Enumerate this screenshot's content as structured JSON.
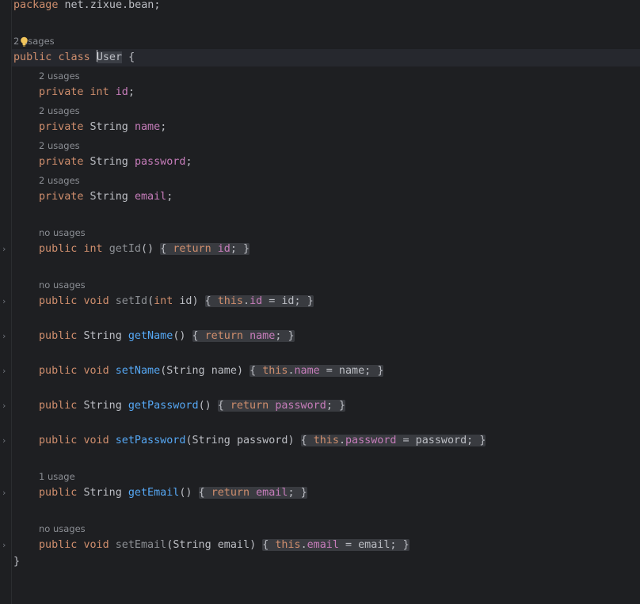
{
  "package_line": {
    "keyword": "package",
    "name": "net.zixue.bean;"
  },
  "class_hint": "2 usages",
  "class_decl": {
    "kw1": "public",
    "kw2": "class",
    "name": "User",
    "brace": "{"
  },
  "fields": [
    {
      "hint": "2 usages",
      "kw": "private",
      "type": "int",
      "name": "id",
      "end": ";"
    },
    {
      "hint": "2 usages",
      "kw": "private",
      "type": "String",
      "name": "name",
      "end": ";"
    },
    {
      "hint": "2 usages",
      "kw": "private",
      "type": "String",
      "name": "password",
      "end": ";"
    },
    {
      "hint": "2 usages",
      "kw": "private",
      "type": "String",
      "name": "email",
      "end": ";"
    }
  ],
  "methods": [
    {
      "hint": "no usages",
      "kw": "public",
      "ret": "int",
      "name": "getId",
      "params": "()",
      "ret_kw": "return",
      "field": "id",
      "semi": ";"
    },
    {
      "hint": "no usages",
      "kw": "public",
      "ret": "void",
      "name": "setId",
      "params_open": "(",
      "param_type": "int",
      "param_name": "id",
      "params_close": ")",
      "this_kw": "this",
      "field": "id",
      "assign": " = id;"
    },
    {
      "kw": "public",
      "ret": "String",
      "name": "getName",
      "params": "()",
      "ret_kw": "return",
      "field": "name",
      "semi": ";"
    },
    {
      "kw": "public",
      "ret": "void",
      "name": "setName",
      "params_open": "(",
      "param_type": "String",
      "param_name": "name",
      "params_close": ")",
      "this_kw": "this",
      "field": "name",
      "assign": " = name;"
    },
    {
      "kw": "public",
      "ret": "String",
      "name": "getPassword",
      "params": "()",
      "ret_kw": "return",
      "field": "password",
      "semi": ";"
    },
    {
      "kw": "public",
      "ret": "void",
      "name": "setPassword",
      "params_open": "(",
      "param_type": "String",
      "param_name": "password",
      "params_close": ")",
      "this_kw": "this",
      "field": "password",
      "assign": " = password;"
    },
    {
      "hint": "1 usage",
      "kw": "public",
      "ret": "String",
      "name": "getEmail",
      "params": "()",
      "ret_kw": "return",
      "field": "email",
      "semi": ";"
    },
    {
      "hint": "no usages",
      "kw": "public",
      "ret": "void",
      "name": "setEmail",
      "params_open": "(",
      "param_type": "String",
      "param_name": "email",
      "params_close": ")",
      "this_kw": "this",
      "field": "email",
      "assign": " = email;"
    }
  ],
  "brace_open": "{",
  "brace_close": "}",
  "fold_glyph": "›",
  "class_close": "}",
  "icons": {
    "intention": "lightbulb-icon",
    "fold": "fold-arrow-icon"
  },
  "colors": {
    "background": "#1e1f22",
    "keyword": "#cf8e6d",
    "field": "#c77dbb",
    "method": "#56a8f5",
    "text": "#bcbec4",
    "hint": "#8b8e94"
  }
}
